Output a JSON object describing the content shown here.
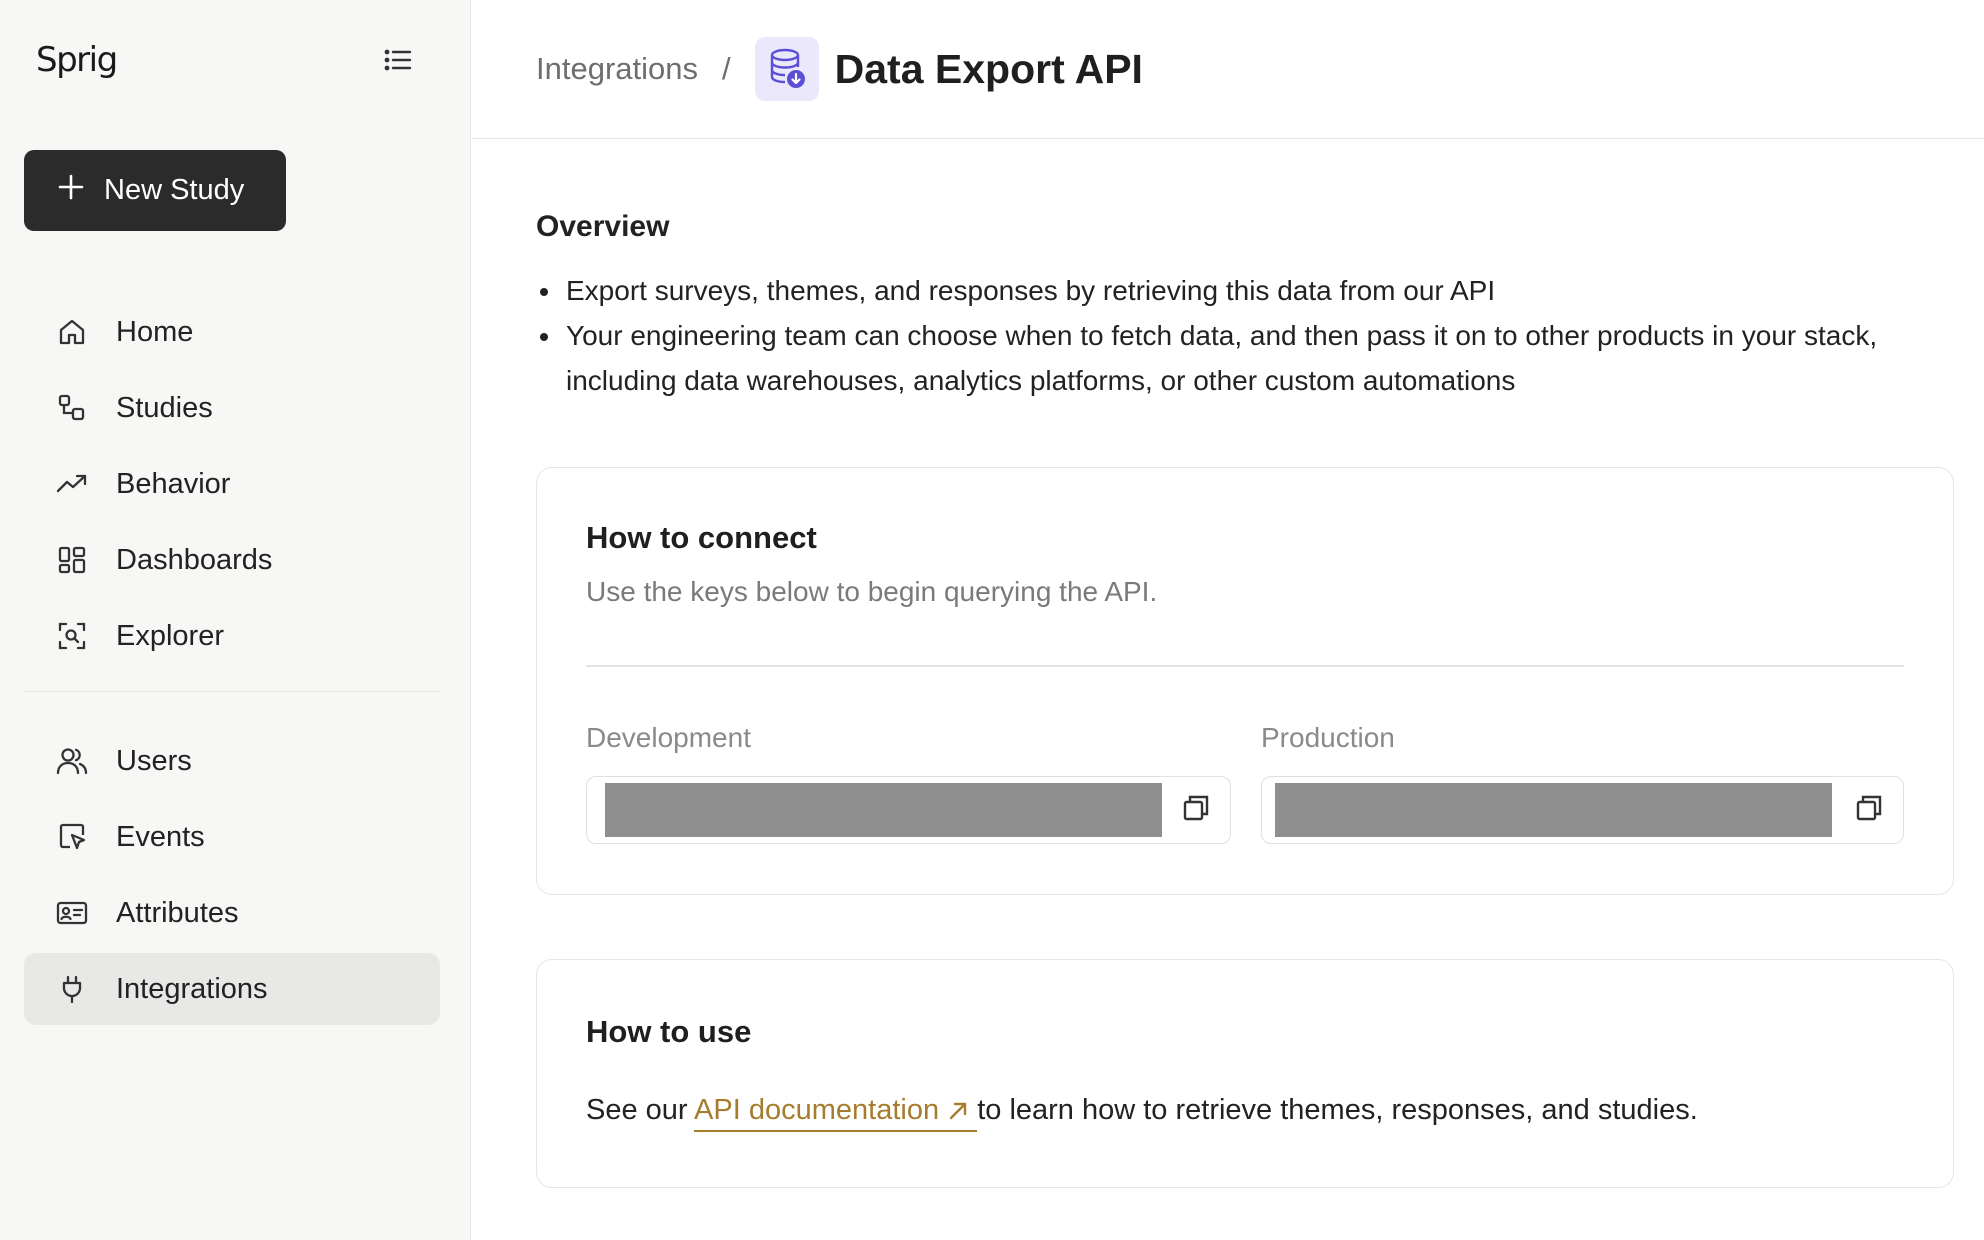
{
  "sidebar": {
    "logo": "Sprig",
    "new_study_label": "New Study",
    "nav_primary": [
      {
        "label": "Home",
        "icon": "home-icon"
      },
      {
        "label": "Studies",
        "icon": "studies-icon"
      },
      {
        "label": "Behavior",
        "icon": "trending-up-icon"
      },
      {
        "label": "Dashboards",
        "icon": "dashboard-icon"
      },
      {
        "label": "Explorer",
        "icon": "explorer-icon"
      }
    ],
    "nav_secondary": [
      {
        "label": "Users",
        "icon": "users-icon"
      },
      {
        "label": "Events",
        "icon": "cursor-click-icon"
      },
      {
        "label": "Attributes",
        "icon": "id-card-icon"
      },
      {
        "label": "Integrations",
        "icon": "plug-icon",
        "active": true
      }
    ]
  },
  "header": {
    "breadcrumb_parent": "Integrations",
    "separator": "/",
    "title": "Data Export API",
    "title_icon": "database-export-icon"
  },
  "overview": {
    "title": "Overview",
    "bullets": [
      "Export surveys, themes, and responses by retrieving this data from our API",
      "Your engineering team can choose when to fetch data, and then pass it on to other products in your stack, including data warehouses, analytics platforms, or other custom automations"
    ]
  },
  "connect": {
    "title": "How to connect",
    "subtitle": "Use the keys below to begin querying the API.",
    "development_label": "Development",
    "production_label": "Production"
  },
  "use": {
    "title": "How to use",
    "text_before": "See our ",
    "link_label": "API documentation",
    "text_after": " to learn how to retrieve themes, responses, and studies."
  },
  "colors": {
    "accent_link": "#a67c2e",
    "primary_button": "#2b2b2b",
    "icon_purple": "#5b4fd6",
    "masked_key": "#8f8f8f"
  }
}
